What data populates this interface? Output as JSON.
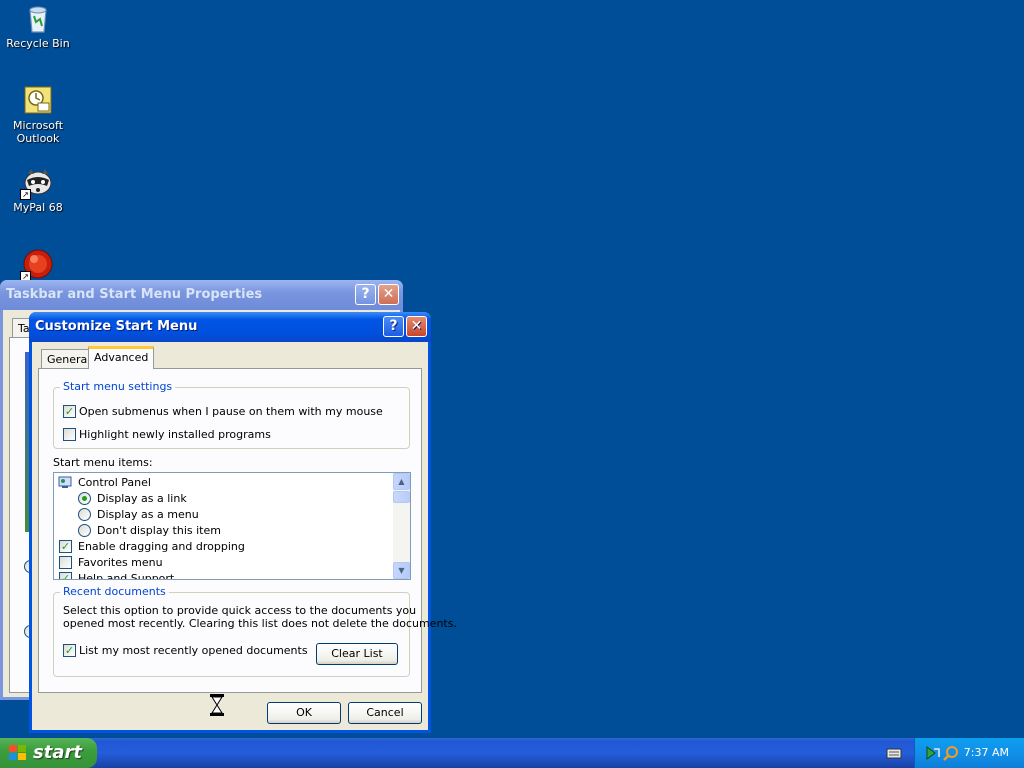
{
  "desktop": {
    "icons": [
      {
        "label": "Recycle Bin"
      },
      {
        "label": "Microsoft\nOutlook"
      },
      {
        "label": "MyPal 68"
      }
    ]
  },
  "taskbar_props_window": {
    "title": "Taskbar and Start Menu Properties",
    "first_tab_partial": "Ta"
  },
  "customize_dialog": {
    "title": "Customize Start Menu",
    "tabs": [
      {
        "label": "General",
        "selected": false
      },
      {
        "label": "Advanced",
        "selected": true
      }
    ],
    "start_menu_settings": {
      "title": "Start menu settings",
      "open_submenus": {
        "label": "Open submenus when I pause on them with my mouse",
        "checked": true
      },
      "highlight_new": {
        "label": "Highlight newly installed programs",
        "checked": false
      }
    },
    "items_label": "Start menu items:",
    "items": [
      {
        "label": "Control Panel",
        "kind": "header"
      },
      {
        "label": "Display as a link",
        "kind": "radio",
        "checked": true
      },
      {
        "label": "Display as a menu",
        "kind": "radio",
        "checked": false
      },
      {
        "label": "Don't display this item",
        "kind": "radio",
        "checked": false
      },
      {
        "label": "Enable dragging and dropping",
        "kind": "checkbox",
        "checked": true
      },
      {
        "label": "Favorites menu",
        "kind": "checkbox",
        "checked": false
      },
      {
        "label": "Help and Support",
        "kind": "checkbox",
        "checked": true
      }
    ],
    "recent_documents": {
      "title": "Recent documents",
      "description_line1": "Select this option to provide quick access to the documents you",
      "description_line2": "opened most recently.  Clearing this list does not delete the documents.",
      "list_recent": {
        "label": "List my most recently opened documents",
        "checked": true
      },
      "clear_button": "Clear List"
    },
    "ok_button": "OK",
    "cancel_button": "Cancel"
  },
  "taskbar": {
    "start_label": "start",
    "clock": "7:37 AM"
  },
  "colors": {
    "desktop": "#004e98",
    "accent_tab": "#ffc83c",
    "group_title": "#0046d5",
    "check": "#21a121"
  }
}
